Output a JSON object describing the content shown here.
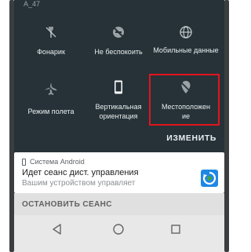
{
  "status": {
    "network_name": "A_47"
  },
  "quick_settings": [
    {
      "label": "Фонарик",
      "icon": "flashlight-icon"
    },
    {
      "label": "Не беспокоить",
      "icon": "do-not-disturb-off-icon"
    },
    {
      "label": "Мобильные данные",
      "icon": "globe-icon"
    },
    {
      "label": "Режим полета",
      "icon": "airplane-mode-icon"
    },
    {
      "label": "Вертикальная ориентация",
      "icon": "portrait-orientation-icon"
    },
    {
      "label": "Местоположение",
      "icon": "location-off-icon"
    }
  ],
  "location_label_lines": [
    "Местоположен",
    "ие"
  ],
  "edit_label": "ИЗМЕНИТЬ",
  "notification": {
    "source": "Система Android",
    "title": "Идет сеанс дист. управления",
    "subtitle": "Вашим устройством управляет",
    "app_icon": "remote-support-app-icon"
  },
  "stop_session_label": "ОСТАНОВИТЬ СЕАНС",
  "nav": {
    "back": "back-icon",
    "home": "home-icon",
    "recents": "recents-icon"
  },
  "colors": {
    "shade": "#263238",
    "highlight": "#e3141b",
    "tile_icon": "#e9eef0"
  }
}
